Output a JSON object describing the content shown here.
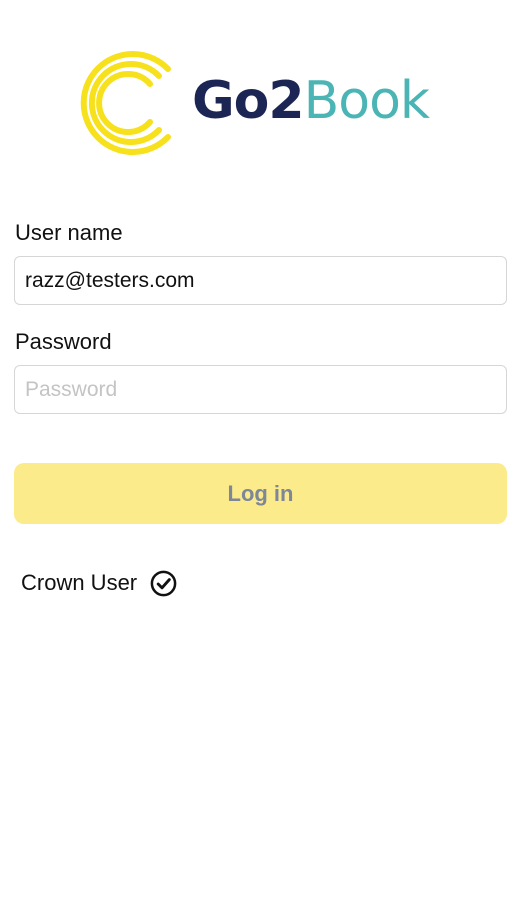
{
  "brand": {
    "name_part_a": "Go2",
    "name_part_b": "Book",
    "logo_icon": "concentric-c-icon",
    "primary_color": "#1c2654",
    "secondary_color": "#4bb4b4",
    "logo_mark_color": "#f7e11c"
  },
  "form": {
    "username": {
      "label": "User name",
      "value": "razz@testers.com"
    },
    "password": {
      "label": "Password",
      "placeholder": "Password",
      "value": ""
    },
    "login_button": {
      "label": "Log in",
      "color": "#fceb8a"
    },
    "crown_user": {
      "label": "Crown User",
      "icon": "check-circle-icon",
      "checked": true
    }
  }
}
